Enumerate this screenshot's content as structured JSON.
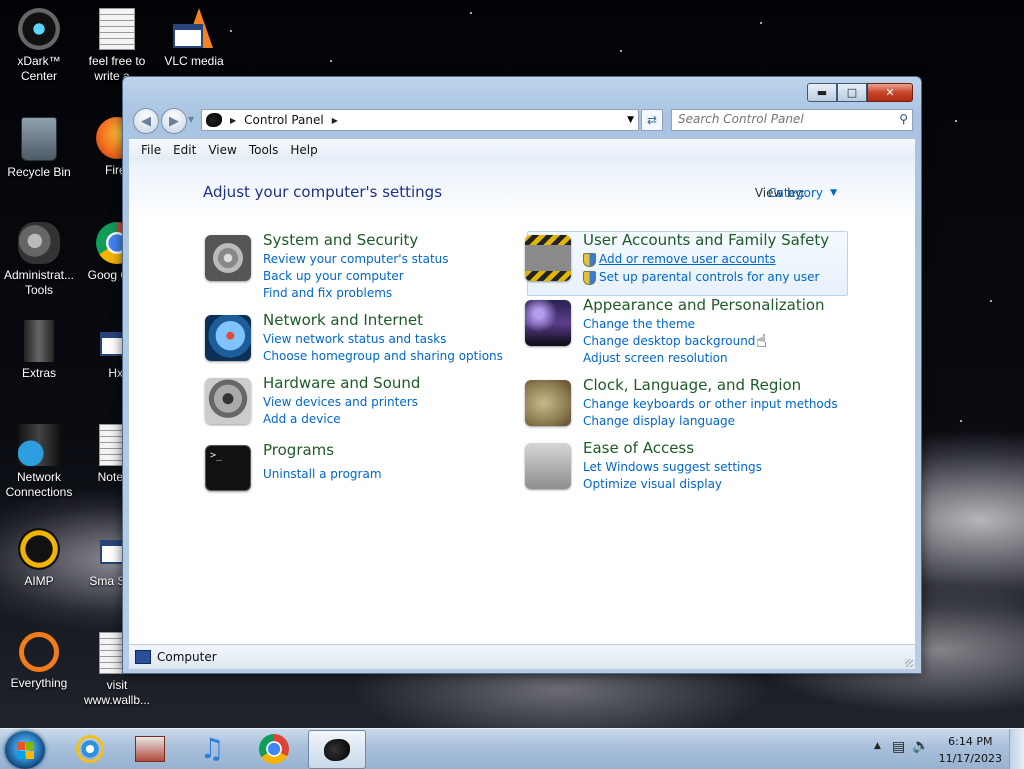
{
  "desktop_icons": [
    {
      "label": "xDark™ Center"
    },
    {
      "label": "feel free to write a..."
    },
    {
      "label": "VLC media"
    },
    {
      "label": "Recycle Bin"
    },
    {
      "label": "Firef"
    },
    {
      "label": "Administrat... Tools"
    },
    {
      "label": "Goog Chro"
    },
    {
      "label": "Extras"
    },
    {
      "label": "Hxl"
    },
    {
      "label": "Network Connections"
    },
    {
      "label": "Notepa"
    },
    {
      "label": "AIMP"
    },
    {
      "label": "Sma Servi"
    },
    {
      "label": "Everything"
    },
    {
      "label": "visit www.wallb..."
    }
  ],
  "window": {
    "address": {
      "path": "Control Panel"
    },
    "search": {
      "placeholder": "Search Control Panel"
    },
    "menu": [
      "File",
      "Edit",
      "View",
      "Tools",
      "Help"
    ],
    "page_title": "Adjust your computer's settings",
    "view_by_label": "View by:",
    "view_by_value": "Category",
    "categories_left": [
      {
        "title": "System and Security",
        "links": [
          "Review your computer's status",
          "Back up your computer",
          "Find and fix problems"
        ]
      },
      {
        "title": "Network and Internet",
        "links": [
          "View network status and tasks",
          "Choose homegroup and sharing options"
        ]
      },
      {
        "title": "Hardware and Sound",
        "links": [
          "View devices and printers",
          "Add a device"
        ]
      },
      {
        "title": "Programs",
        "links": [
          "Uninstall a program"
        ]
      }
    ],
    "categories_right": [
      {
        "title": "User Accounts and Family Safety",
        "links": [
          "Add or remove user accounts",
          "Set up parental controls for any user"
        ]
      },
      {
        "title": "Appearance and Personalization",
        "links": [
          "Change the theme",
          "Change desktop background",
          "Adjust screen resolution"
        ]
      },
      {
        "title": "Clock, Language, and Region",
        "links": [
          "Change keyboards or other input methods",
          "Change display language"
        ]
      },
      {
        "title": "Ease of Access",
        "links": [
          "Let Windows suggest settings",
          "Optimize visual display"
        ]
      }
    ],
    "status_text": "Computer"
  },
  "taskbar": {
    "pinned": [
      "internet-explorer-icon",
      "media-center-icon",
      "itunes-icon",
      "chrome-icon",
      "control-panel-icon"
    ],
    "clock": {
      "time": "6:14 PM",
      "date": "11/17/2023"
    }
  },
  "colors": {
    "link": "#0066cc",
    "category_title": "#1e5b27",
    "page_title": "#1e3287"
  }
}
